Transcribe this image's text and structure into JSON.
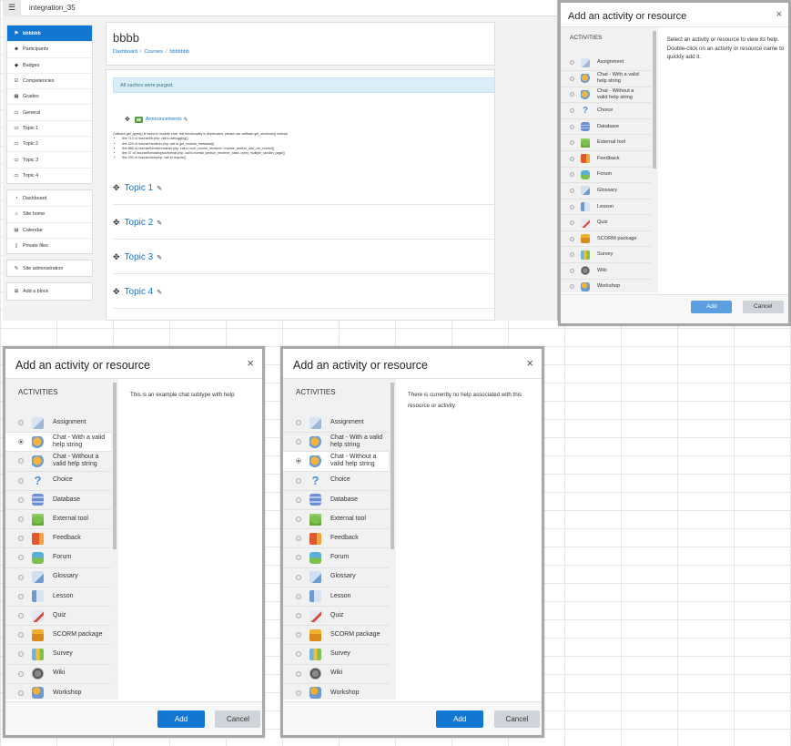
{
  "page": {
    "site_name": "integration_35",
    "menu_icon": "hamburger-icon"
  },
  "nav": {
    "course_block": [
      {
        "label": "bbbbbb",
        "icon": "graduation-cap-icon",
        "active": true
      },
      {
        "label": "Participants",
        "icon": "users-icon"
      },
      {
        "label": "Badges",
        "icon": "shield-icon"
      },
      {
        "label": "Competencies",
        "icon": "check-square-icon"
      },
      {
        "label": "Grades",
        "icon": "table-icon"
      },
      {
        "label": "General",
        "icon": "folder-icon"
      },
      {
        "label": "Topic 1",
        "icon": "folder-icon"
      },
      {
        "label": "Topic 2",
        "icon": "folder-icon"
      },
      {
        "label": "Topic 3",
        "icon": "folder-icon"
      },
      {
        "label": "Topic 4",
        "icon": "folder-icon"
      }
    ],
    "site_block": [
      {
        "label": "Dashboard",
        "icon": "dashboard-icon"
      },
      {
        "label": "Site home",
        "icon": "home-icon"
      },
      {
        "label": "Calendar",
        "icon": "calendar-icon"
      },
      {
        "label": "Private files",
        "icon": "file-icon"
      }
    ],
    "admin_block": [
      {
        "label": "Site administration",
        "icon": "wrench-icon"
      }
    ],
    "block_block": [
      {
        "label": "Add a block",
        "icon": "plus-square-icon"
      }
    ]
  },
  "course": {
    "title": "bbbb",
    "breadcrumb": [
      "Dashboard",
      "Courses",
      "bbbbbbb"
    ],
    "alert": "All caches were purged.",
    "announcements": "Announcements",
    "debug_heading": "Callback get_types() is found in module chat, this functionality is deprecated, please use callback get_shortcuts() instead",
    "debug_lines": [
      "line 713 of /course/lib.php: call to debugging()",
      "line 320 of /course/renderer.php: call to get_module_metadata()",
      "line 888 of /course/format/renderer.php: call to core_course_renderer->course_section_add_cm_control()",
      "line 57 of /course/format/topics/format.php: call to format_section_renderer_base->print_multiple_section_page()",
      "line 290 of /course/view.php: call to require()"
    ],
    "sections": [
      "Topic 1",
      "Topic 2",
      "Topic 3",
      "Topic 4"
    ]
  },
  "dialog": {
    "title": "Add an activity or resource",
    "close": "×",
    "activities_heading": "ACTIVITIES",
    "add_label": "Add",
    "cancel_label": "Cancel",
    "modules": [
      {
        "label": "Assignment",
        "icon": "assignment-icon",
        "cls": "ic-assign"
      },
      {
        "label": "Chat - With a valid help string",
        "icon": "chat-icon",
        "cls": "ic-chat"
      },
      {
        "label": "Chat - Without a valid help string",
        "icon": "chat-icon",
        "cls": "ic-chat"
      },
      {
        "label": "Choice",
        "icon": "question-mark-icon",
        "cls": "ic-choice"
      },
      {
        "label": "Database",
        "icon": "database-icon",
        "cls": "ic-db"
      },
      {
        "label": "External tool",
        "icon": "puzzle-piece-icon",
        "cls": "ic-ext"
      },
      {
        "label": "Feedback",
        "icon": "megaphone-icon",
        "cls": "ic-feed"
      },
      {
        "label": "Forum",
        "icon": "forum-icon",
        "cls": "ic-forum"
      },
      {
        "label": "Glossary",
        "icon": "glossary-icon",
        "cls": "ic-gloss"
      },
      {
        "label": "Lesson",
        "icon": "lesson-icon",
        "cls": "ic-lesson"
      },
      {
        "label": "Quiz",
        "icon": "quiz-icon",
        "cls": "ic-quiz"
      },
      {
        "label": "SCORM package",
        "icon": "scorm-package-icon",
        "cls": "ic-scorm"
      },
      {
        "label": "Survey",
        "icon": "bar-chart-icon",
        "cls": "ic-survey"
      },
      {
        "label": "Wiki",
        "icon": "wiki-icon",
        "cls": "ic-wiki"
      },
      {
        "label": "Workshop",
        "icon": "workshop-icon",
        "cls": "ic-work"
      }
    ],
    "instances": [
      {
        "name": "default",
        "help": "Select an activity or resource to view its help. Double-click on an activity or resource name to quickly add it.",
        "selected": -1,
        "add_dim": true
      },
      {
        "name": "with-help",
        "help": "This is an example chat subtype with help",
        "selected": 1,
        "add_dim": false
      },
      {
        "name": "without-help",
        "help": "There is currently no help associated with this resource or activity",
        "selected": 2,
        "add_dim": false
      }
    ]
  }
}
